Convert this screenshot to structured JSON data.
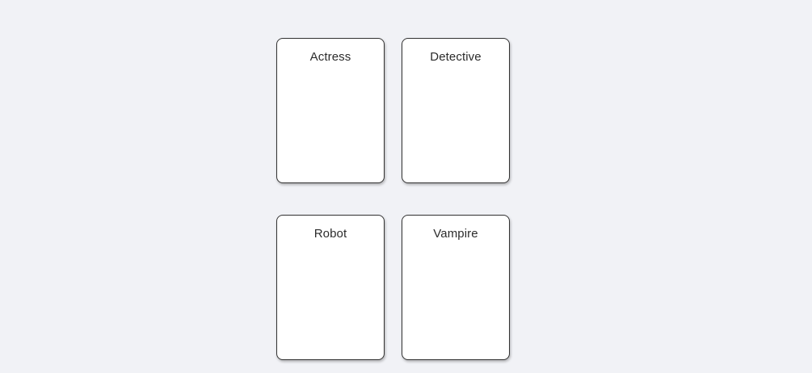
{
  "cards": [
    {
      "label": "Actress"
    },
    {
      "label": "Detective"
    },
    {
      "label": "Robot"
    },
    {
      "label": "Vampire"
    }
  ]
}
